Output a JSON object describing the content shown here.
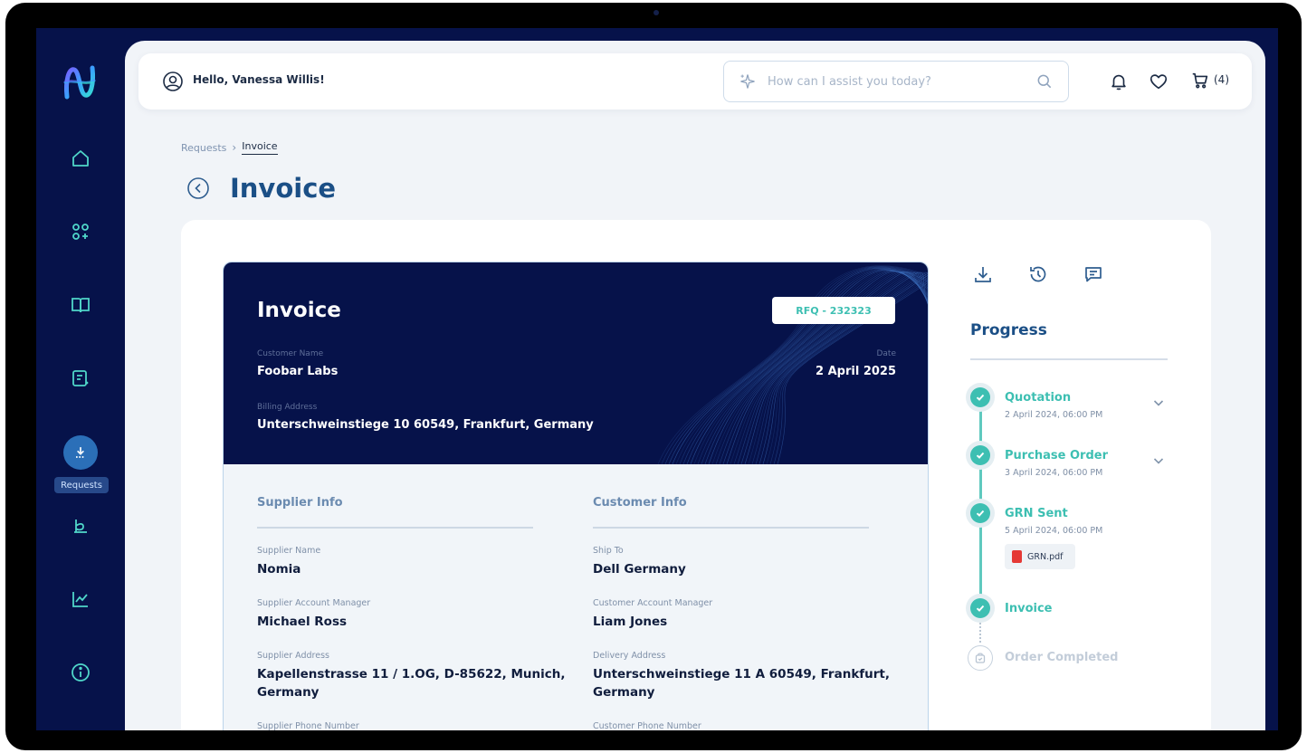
{
  "header": {
    "greeting": "Hello, Vanessa Willis!",
    "search_placeholder": "How can I assist you today?",
    "cart_count": "(4)"
  },
  "sidebar": {
    "items": [
      {
        "icon": "home-icon"
      },
      {
        "icon": "apps-icon"
      },
      {
        "icon": "book-icon"
      },
      {
        "icon": "notes-icon"
      },
      {
        "icon": "requests-icon",
        "label": "Requests",
        "active": true
      },
      {
        "icon": "sign-icon"
      },
      {
        "icon": "chart-icon"
      },
      {
        "icon": "info-icon"
      }
    ]
  },
  "breadcrumb": {
    "parent": "Requests",
    "current": "Invoice"
  },
  "page": {
    "title": "Invoice"
  },
  "invoice": {
    "title": "Invoice",
    "rfq": "RFQ - 232323",
    "customer_name_label": "Customer Name",
    "customer_name": "Foobar Labs",
    "date_label": "Date",
    "date": "2 April 2025",
    "billing_address_label": "Billing Address",
    "billing_address": "Unterschweinstiege 10 60549, Frankfurt, Germany",
    "supplier": {
      "section_title": "Supplier Info",
      "name_label": "Supplier Name",
      "name": "Nomia",
      "manager_label": "Supplier Account Manager",
      "manager": "Michael Ross",
      "address_label": "Supplier Address",
      "address_line1": "Kapellenstrasse 11 / 1.OG, D-85622, Munich,",
      "address_line2": "Germany",
      "phone_label": "Supplier Phone Number"
    },
    "customer": {
      "section_title": "Customer Info",
      "ship_to_label": "Ship To",
      "ship_to": "Dell Germany",
      "manager_label": "Customer Account Manager",
      "manager": "Liam Jones",
      "address_label": "Delivery Address",
      "address_line1": "Unterschweinstiege 11 A 60549, Frankfurt,",
      "address_line2": "Germany",
      "phone_label": "Customer Phone Number"
    }
  },
  "progress": {
    "title": "Progress",
    "steps": [
      {
        "title": "Quotation",
        "date": "2 April 2024, 06:00 PM"
      },
      {
        "title": "Purchase Order",
        "date": "3 April 2024, 06:00 PM"
      },
      {
        "title": "GRN Sent",
        "date": "5 April 2024, 06:00 PM",
        "file": "GRN.pdf"
      },
      {
        "title": "Invoice"
      },
      {
        "title": "Order Completed"
      }
    ]
  },
  "colors": {
    "navy": "#06124a",
    "accent_teal": "#3dbfb2",
    "title_blue": "#1b4f86"
  }
}
